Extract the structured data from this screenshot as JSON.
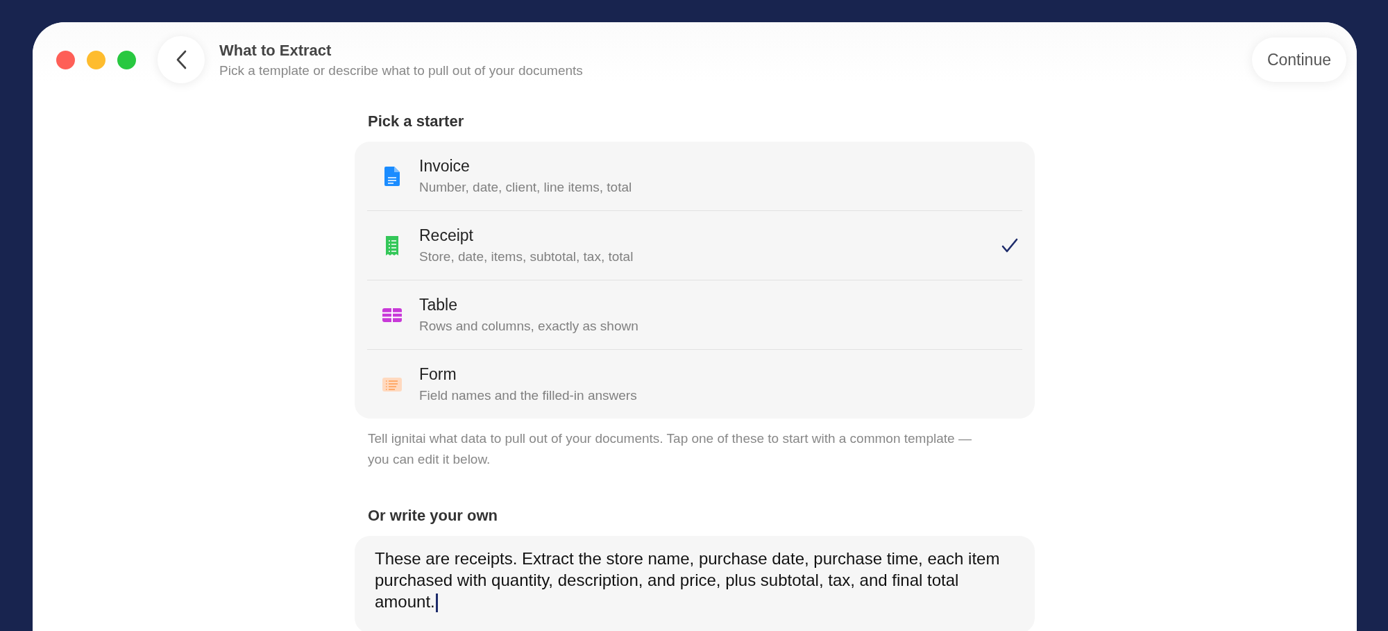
{
  "window": {
    "title": "What to Extract",
    "subtitle": "Pick a template or describe what to pull out of your documents"
  },
  "continue_button": "Continue",
  "starters": {
    "heading": "Pick a starter",
    "items": [
      {
        "kind": "document",
        "title": "Invoice",
        "description": "Number, date, client, line items, total",
        "selected": false
      },
      {
        "kind": "receipt",
        "title": "Receipt",
        "description": "Store, date, items, subtotal, tax, total",
        "selected": true
      },
      {
        "kind": "table",
        "title": "Table",
        "description": "Rows and columns, exactly as shown",
        "selected": false
      },
      {
        "kind": "form",
        "title": "Form",
        "description": "Field names and the filled-in answers",
        "selected": false
      }
    ],
    "help": "Tell ignitai what data to pull out of your documents. Tap one of these to start with a common template — you can edit it below."
  },
  "custom": {
    "heading": "Or write your own",
    "value": "These are receipts. Extract the store name, purchase date, purchase time, each item purchased with quantity, description, and price, plus subtotal, tax, and final total amount."
  }
}
